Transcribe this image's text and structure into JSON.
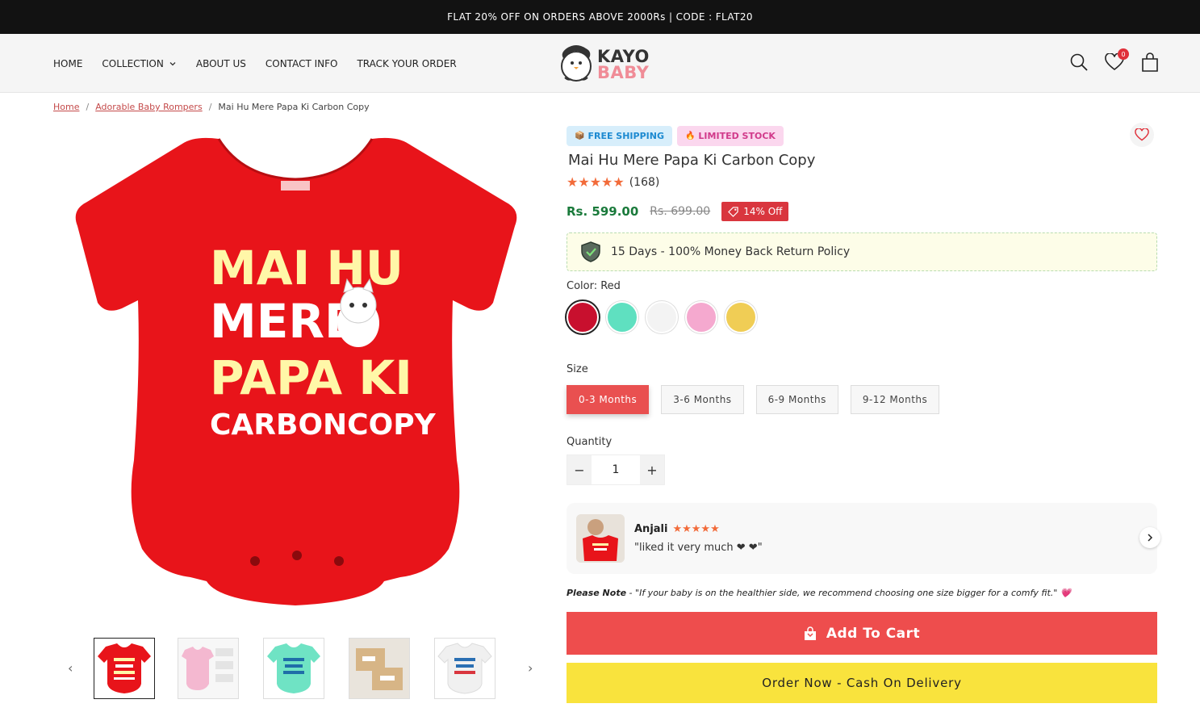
{
  "announcement": "FLAT 20% OFF ON ORDERS ABOVE 2000Rs | CODE : FLAT20",
  "nav": {
    "home": "HOME",
    "collection": "COLLECTION",
    "about": "ABOUT US",
    "contact": "CONTACT INFO",
    "track": "TRACK YOUR ORDER"
  },
  "logo": {
    "top": "KAYO",
    "bottom": "BABY"
  },
  "header": {
    "wishlist_count": "0"
  },
  "breadcrumb": [
    "Home",
    "Adorable Baby Rompers",
    "Mai Hu Mere Papa Ki Carbon Copy"
  ],
  "product": {
    "badge_shipping": "FREE SHIPPING",
    "badge_stock": "LIMITED STOCK",
    "title": "Mai Hu Mere Papa Ki Carbon Copy",
    "stars": "★★★★★",
    "review_count": "(168)",
    "price": "Rs. 599.00",
    "price_old": "Rs. 699.00",
    "discount": "14% Off",
    "policy": "15 Days - 100% Money Back Return Policy",
    "color_label": "Color: Red",
    "colors": [
      "#c8102e",
      "#5fe0c0",
      "#f3f3f3",
      "#f5a9cf",
      "#f0cd55"
    ],
    "size_label": "Size",
    "sizes": [
      "0-3 Months",
      "3-6 Months",
      "6-9 Months",
      "9-12 Months"
    ],
    "quantity_label": "Quantity",
    "quantity": "1",
    "print_lines": [
      "MAI HU",
      "MERE",
      "PAPA KI",
      "CARBONCOPY"
    ]
  },
  "review": {
    "name": "Anjali",
    "stars": "★★★★★",
    "text": "\"liked it very much ❤ ❤\""
  },
  "note": {
    "label": "Please Note",
    "text": " - \"If your baby is on the healthier side, we recommend choosing one size bigger for a comfy fit.\" 💗"
  },
  "buttons": {
    "add_to_cart": "Add To Cart",
    "cod": "Order Now - Cash On Delivery"
  },
  "colors": {
    "accent": "#ee4d4d",
    "cod": "#f9e33d",
    "price": "#1a7a3b"
  }
}
